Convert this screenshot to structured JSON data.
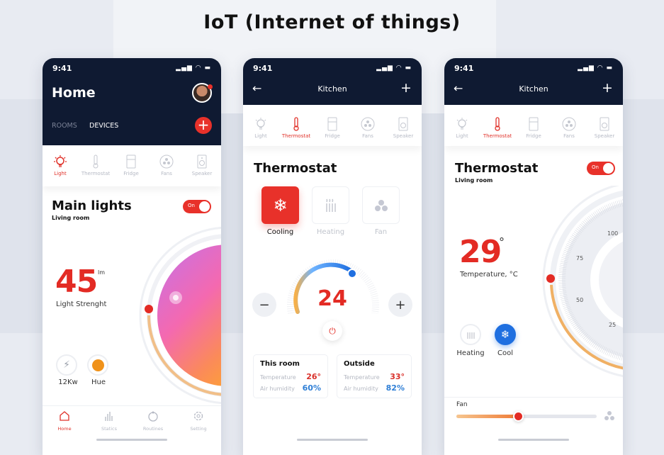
{
  "page_title": "IoT (Internet of things)",
  "colors": {
    "header": "#0f1a32",
    "accent": "#e8312a",
    "blue": "#2f7fd6",
    "orange": "#f0a44a"
  },
  "status_time": "9:41",
  "device_tabs": [
    "Light",
    "Thermostat",
    "Fridge",
    "Fans",
    "Speaker"
  ],
  "home": {
    "title": "Home",
    "tabs": [
      "ROOMS",
      "DEVICES"
    ],
    "active_tab": "DEVICES",
    "active_device": "Light",
    "device_title": "Main lights",
    "room": "Living room",
    "toggle": "On",
    "value": "45",
    "unit": "lm",
    "value_label": "Light Strenght",
    "power_label": "12Kw",
    "hue_label": "Hue",
    "hue_color": "#f0921a",
    "nav": [
      "Home",
      "Statics",
      "Routines",
      "Setting"
    ],
    "active_nav": "Home"
  },
  "kitchen": {
    "title": "Kitchen",
    "active_device": "Thermostat",
    "section_title": "Thermostat",
    "modes": [
      "Cooling",
      "Heating",
      "Fan"
    ],
    "active_mode": "Cooling",
    "set_temp": "24",
    "this_room": {
      "title": "This room",
      "temp_label": "Temperature",
      "temp": "26°",
      "hum_label": "Air humidity",
      "hum": "60%"
    },
    "outside": {
      "title": "Outside",
      "temp_label": "Temperature",
      "temp": "33°",
      "hum_label": "Air humidity",
      "hum": "82%"
    }
  },
  "thermo": {
    "title": "Kitchen",
    "active_device": "Thermostat",
    "section_title": "Thermostat",
    "room": "Living room",
    "toggle": "On",
    "value": "29",
    "unit": "°",
    "value_label": "Temperature, °C",
    "dial_ticks": [
      "100",
      "75",
      "50",
      "25"
    ],
    "modes": [
      "Heating",
      "Cool"
    ],
    "active_mode": "Cool",
    "fan_label": "Fan",
    "fan_level": 0.44
  }
}
